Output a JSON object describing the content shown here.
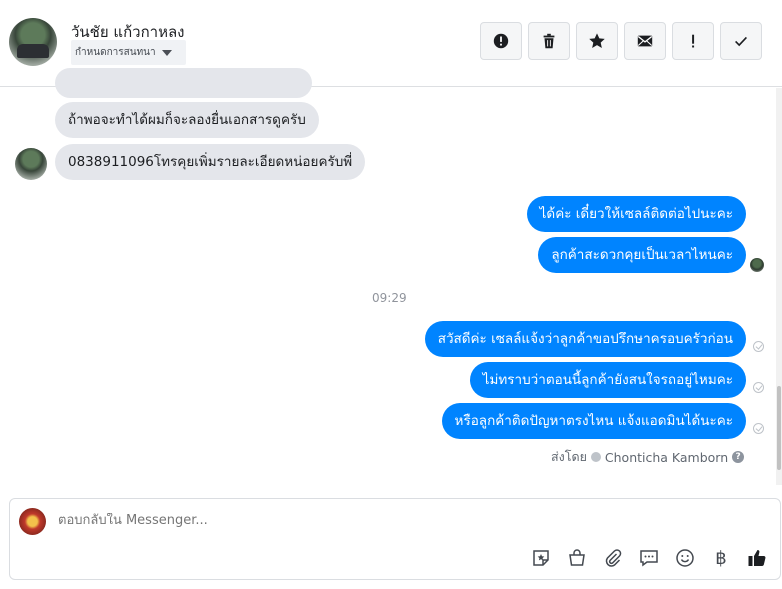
{
  "header": {
    "contact_name": "วันชัย แก้วกาหลง",
    "tag_label": "กำหนดการสนทนา",
    "action_icons": [
      "alert-circle-icon",
      "trash-icon",
      "star-icon",
      "mail-icon",
      "exclamation-icon",
      "check-icon"
    ]
  },
  "messages": {
    "incoming": [
      "ถ้าพอจะทำได้ผมก็จะลองยื่นเอกสารดูครับ",
      "0838911096โทรคุยเพิ่มรายละเอียดหน่อยครับพี่"
    ],
    "outgoing_1": [
      "ได้ค่ะ เดี๋ยวให้เซลล์ติดต่อไปนะคะ",
      "ลูกค้าสะดวกคุยเป็นเวลาไหนคะ"
    ],
    "time_divider": "09:29",
    "outgoing_2": [
      "สวัสดีค่ะ เซลล์แจ้งว่าลูกค้าขอปรึกษาครอบครัวก่อน",
      "ไม่ทราบว่าตอนนี้ลูกค้ายังสนใจรถอยู่ไหมคะ",
      "หรือลูกค้าติดปัญหาตรงไหน แจ้งแอดมินได้นะคะ"
    ],
    "sent_by_prefix": "ส่งโดย",
    "sent_by_name": "Chonticha Kamborn"
  },
  "composer": {
    "placeholder": "ตอบกลับใน Messenger...",
    "tool_icons": [
      "sticker-icon",
      "shopping-bag-icon",
      "paperclip-icon",
      "saved-reply-icon",
      "emoji-icon",
      "baht-icon",
      "like-icon"
    ],
    "baht_symbol": "฿"
  },
  "colors": {
    "outgoing_bubble": "#0084ff",
    "incoming_bubble": "#e4e6eb",
    "header_border": "#dddfe2"
  }
}
